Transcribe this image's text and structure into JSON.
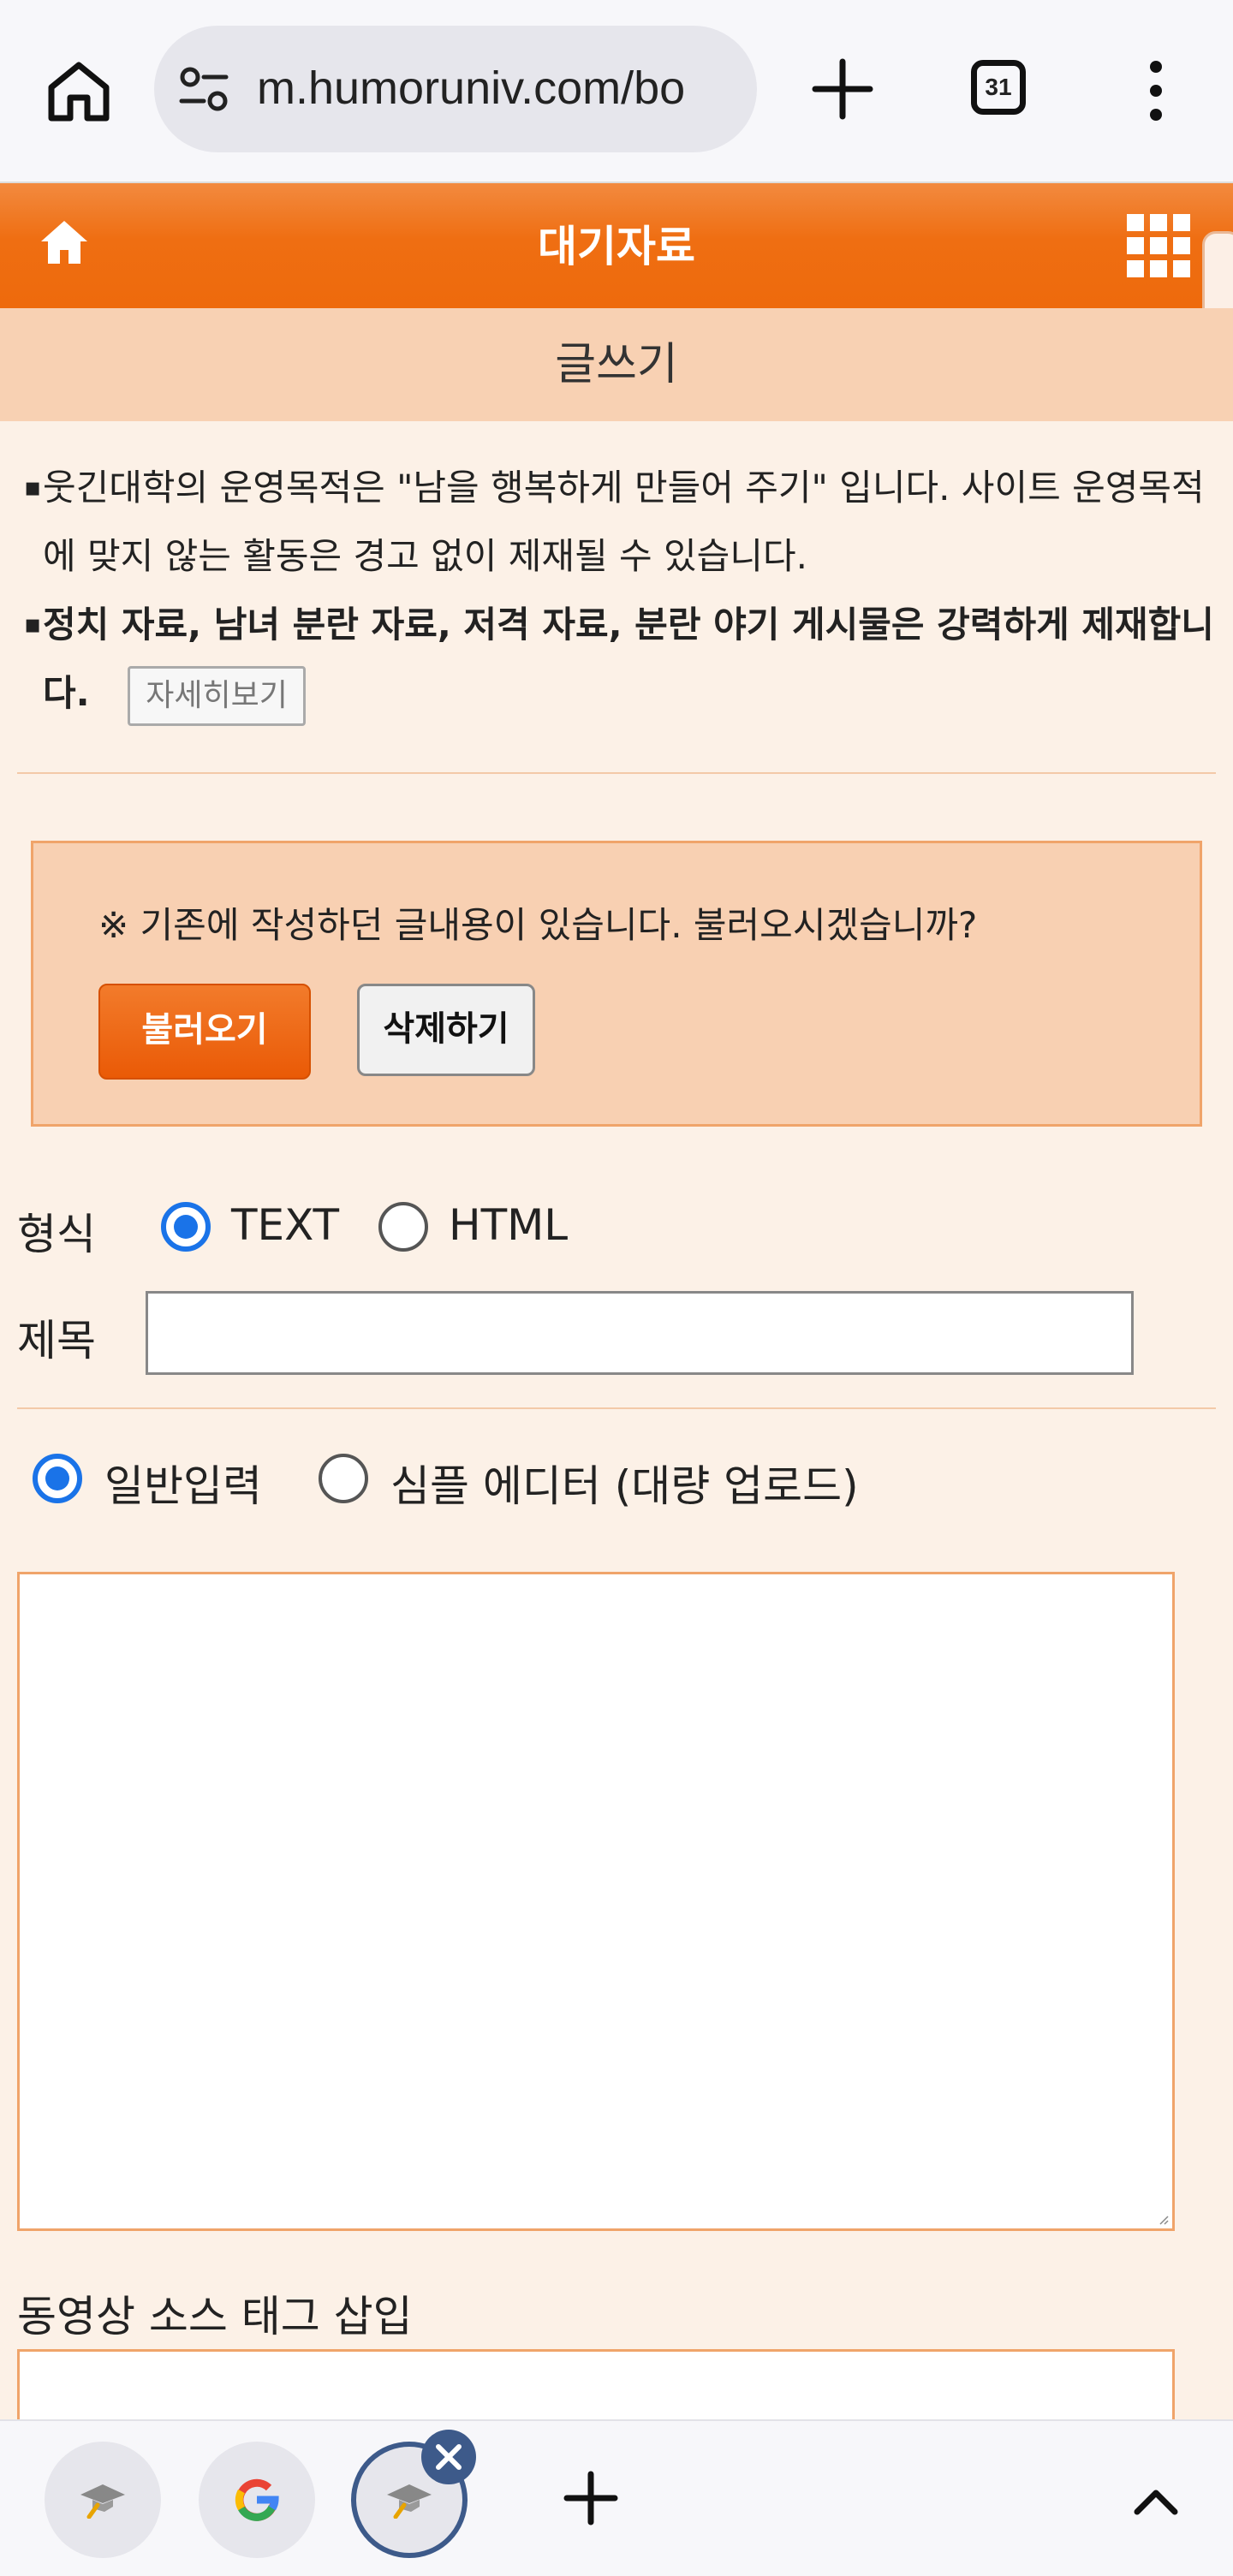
{
  "browser": {
    "url": "m.humoruniv.com/bo",
    "tab_count": "31"
  },
  "header": {
    "title": "대기자료"
  },
  "sub_header": {
    "title": "글쓰기"
  },
  "notice": {
    "line1": "웃긴대학의 운영목적은 \"남을 행복하게 만들어 주기\" 입니다. 사이트 운영목적에 맞지 않는 활동은 경고 없이 제재될 수 있습니다.",
    "line2": "정치 자료, 남녀 분란 자료, 저격 자료, 분란 야기 게시물은 강력하게 제재합니다.",
    "detail_button": "자세히보기"
  },
  "draft": {
    "message": "※ 기존에 작성하던 글내용이 있습니다. 불러오시겠습니까?",
    "load_button": "불러오기",
    "delete_button": "삭제하기"
  },
  "form": {
    "format_label": "형식",
    "format_options": [
      "TEXT",
      "HTML"
    ],
    "format_selected": "TEXT",
    "title_label": "제목",
    "title_value": "",
    "input_modes": [
      "일반입력",
      "심플 에디터 (대량 업로드)"
    ],
    "input_mode_selected": "일반입력",
    "content_value": "",
    "video_label": "동영상 소스 태그 삽입"
  },
  "bottom_tabs": {
    "items": [
      "humoruniv-tab",
      "google-tab",
      "humoruniv-tab-active"
    ]
  },
  "colors": {
    "header_orange": "#ee6a0c",
    "sub_header": "#f8d1b3",
    "page_bg": "#fcf1e7",
    "radio_blue": "#1a73e8"
  }
}
